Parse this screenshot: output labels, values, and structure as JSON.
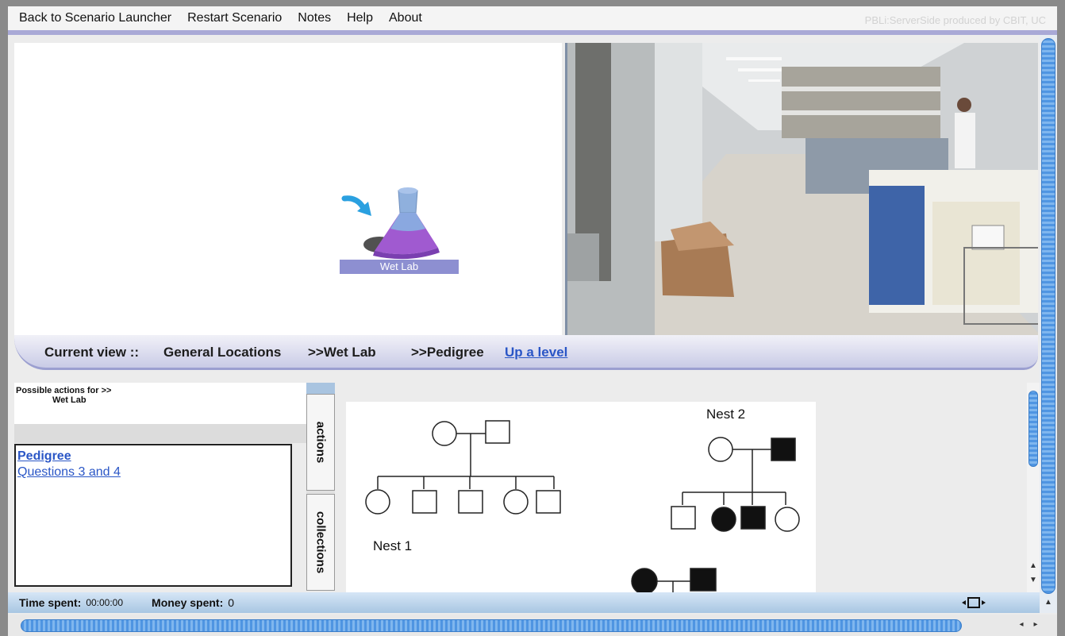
{
  "menu": {
    "items": [
      "Back to Scenario Launcher",
      "Restart Scenario",
      "Notes",
      "Help",
      "About"
    ],
    "credit": "PBLi:ServerSide produced by CBIT, UC"
  },
  "map": {
    "location_label": "Wet Lab",
    "icon": "flask-icon",
    "pointer_icon": "arrow-pointer-icon"
  },
  "photo": {
    "icon": "lab-photo"
  },
  "breadcrumb": {
    "prefix": "Current view ::",
    "level1": "General Locations",
    "level2": ">>Wet Lab",
    "level3": ">>Pedigree",
    "up_link": "Up a level"
  },
  "actions": {
    "header_line1": "Possible actions for >>",
    "header_line2": "Wet Lab",
    "items": [
      "Pedigree",
      "Questions 3 and 4"
    ]
  },
  "tabs": [
    "actions",
    "collections"
  ],
  "pedigree": {
    "nest1_label": "Nest 1",
    "nest2_label": "Nest 2"
  },
  "status": {
    "time_label": "Time spent:",
    "time_value": "00:00:00",
    "money_label": "Money spent:",
    "money_value": "0"
  },
  "colors": {
    "accent": "#8d8fd1",
    "link": "#2a56c6",
    "scrollbar": "#4f95e2"
  }
}
